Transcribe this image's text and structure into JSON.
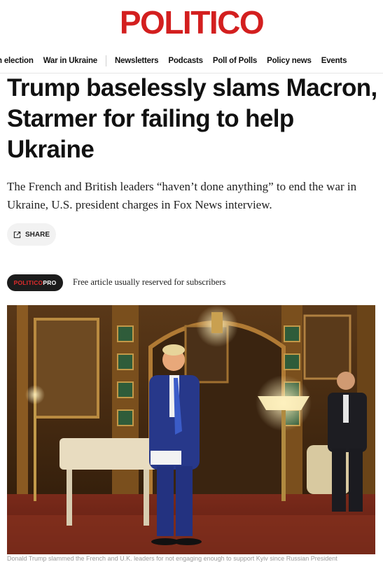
{
  "brand": {
    "logo_text": "POLITICO",
    "color": "#d31f1f"
  },
  "nav": {
    "items": [
      "n election",
      "War in Ukraine",
      "Newsletters",
      "Podcasts",
      "Poll of Polls",
      "Policy news",
      "Events"
    ]
  },
  "article": {
    "headline": "Trump baselessly slams Macron, Starmer for failing to help Ukraine",
    "dek": "The French and British leaders “haven’t done anything” to end the war in Ukraine, U.S. president charges in Fox News interview.",
    "share_label": "SHARE",
    "pro_badge": {
      "part1": "POLITICO",
      "part2": "PRO"
    },
    "pro_note": "Free article usually reserved for subscribers",
    "photo_icon": "press-photo-ballroom",
    "caption": "Donald Trump slammed the French and U.K. leaders for not engaging enough to support Kyiv since Russian President"
  }
}
